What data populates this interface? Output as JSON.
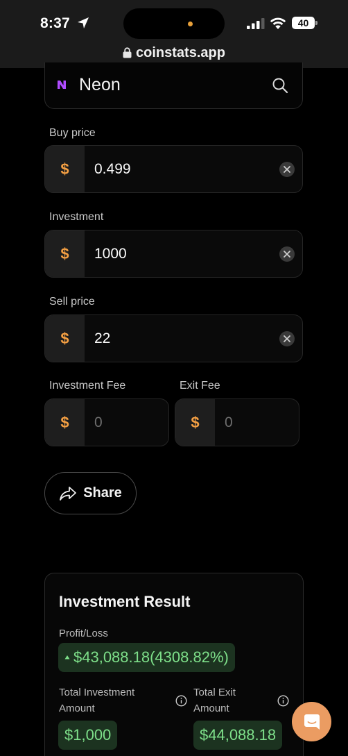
{
  "status_bar": {
    "time": "8:37",
    "battery": "40",
    "url": "coinstats.app"
  },
  "coin": {
    "name": "Neon"
  },
  "fields": {
    "buy_price": {
      "label": "Buy price",
      "prefix": "$",
      "value": "0.499"
    },
    "investment": {
      "label": "Investment",
      "prefix": "$",
      "value": "1000"
    },
    "sell_price": {
      "label": "Sell price",
      "prefix": "$",
      "value": "22"
    },
    "investment_fee": {
      "label": "Investment Fee",
      "prefix": "$",
      "placeholder": "0"
    },
    "exit_fee": {
      "label": "Exit Fee",
      "prefix": "$",
      "placeholder": "0"
    }
  },
  "share": {
    "label": "Share"
  },
  "result": {
    "title": "Investment Result",
    "profit_label": "Profit/Loss",
    "profit_value": "$43,088.18(4308.82%)",
    "total_investment_label": "Total Investment Amount",
    "total_investment_value": "$1,000",
    "total_exit_label": "Total Exit Amount",
    "total_exit_value": "$44,088.18"
  },
  "colors": {
    "accent": "#f5a043",
    "positive_text": "#7ee08a",
    "positive_bg": "#1c3320",
    "chat": "#eb9c62",
    "coin_logo": "#b04cff"
  },
  "icons": {
    "search": "search-icon",
    "clear": "close-icon",
    "share": "share-arrow-icon",
    "info": "info-icon",
    "chat": "chat-icon",
    "lock": "lock-icon"
  }
}
